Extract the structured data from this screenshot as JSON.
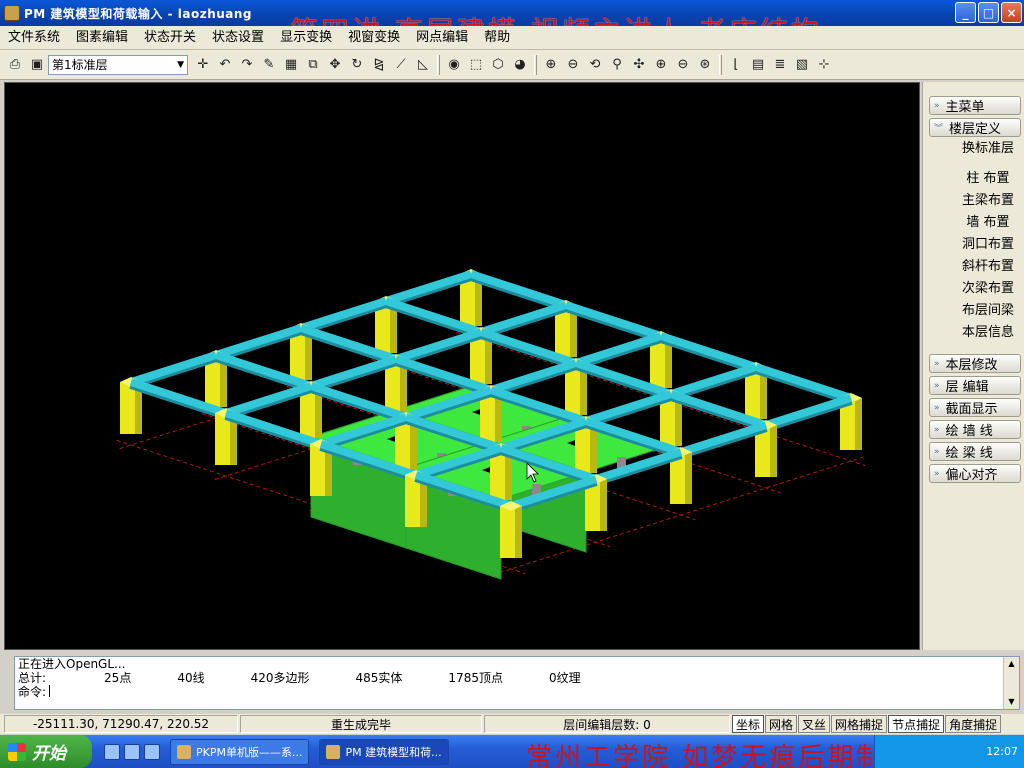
{
  "window": {
    "title": "PM 建筑模型和荷载输入 - laozhuang",
    "overlay_title": "第四讲 高层建模 视频主讲人 老庄结构",
    "buttons": [
      "_",
      "□",
      "×"
    ]
  },
  "menu": {
    "items": [
      "文件系统",
      "图素编辑",
      "状态开关",
      "状态设置",
      "显示变换",
      "视窗变换",
      "网点编辑",
      "帮助"
    ]
  },
  "toolbar": {
    "floor_select": "第1标准层"
  },
  "right_panel": {
    "main_menu": "主菜单",
    "floor_define": "楼层定义",
    "sub_items": [
      "换标准层",
      "柱  布置",
      "主梁布置",
      "墙  布置",
      "洞口布置",
      "斜杆布置",
      "次梁布置",
      "布层间梁",
      "本层信息"
    ],
    "bottom_items": [
      "本层修改",
      "层  编辑",
      "截面显示",
      "绘 墙 线",
      "绘 梁 线",
      "偏心对齐"
    ]
  },
  "console": {
    "line1": "正在进入OpenGL...",
    "total_label": "总计:",
    "stats": [
      "25点",
      "40线",
      "420多边形",
      "485实体",
      "1785顶点",
      "0纹理"
    ],
    "prompt": "命令:"
  },
  "statusbar": {
    "coords": "-25111.30, 71290.47, 220.52",
    "message": "重生成完毕",
    "layer_edit": "层间编辑层数:  0",
    "toggles": [
      "坐标",
      "网格",
      "叉丝",
      "网格捕捉",
      "节点捕捉",
      "角度捕捉"
    ],
    "toggles_on": [
      "坐标",
      "节点捕捉"
    ]
  },
  "taskbar": {
    "start_label": "开始",
    "tasks": [
      "PKPM单机版——系...",
      "PM 建筑模型和荷..."
    ],
    "overlay_credit": "常州工学院 如梦无痕后期制作",
    "clock": "12:07"
  },
  "model": {
    "colors": {
      "column": "#e8e81a",
      "beam": "#33c8d8",
      "slab": "#3ee83e",
      "ground_line": "#b01818",
      "background": "#000000"
    },
    "grid_columns": 5,
    "grid_rows": 5,
    "slab_bays": [
      [
        1,
        1
      ],
      [
        1,
        2
      ],
      [
        2,
        1
      ],
      [
        2,
        2
      ]
    ]
  }
}
